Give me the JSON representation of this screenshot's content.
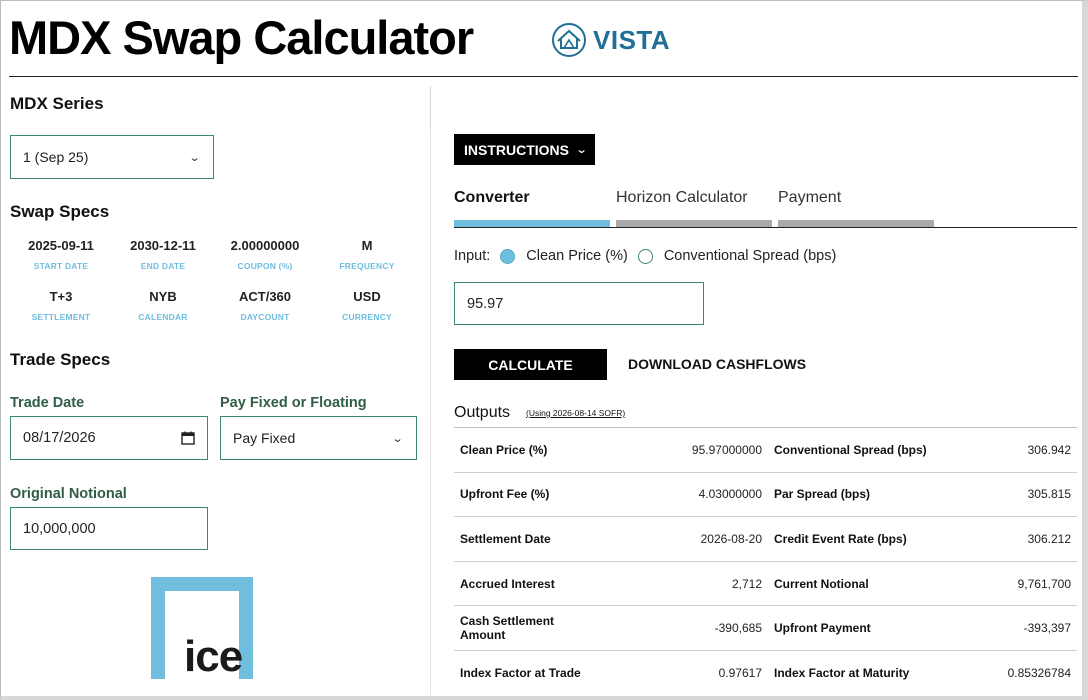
{
  "header": {
    "title": "MDX Swap Calculator",
    "brand": "VISTA"
  },
  "left": {
    "series_heading": "MDX Series",
    "series_select": "1 (Sep 25)",
    "swap_specs_heading": "Swap Specs",
    "swap_specs": [
      {
        "value": "2025-09-11",
        "label": "START DATE"
      },
      {
        "value": "2030-12-11",
        "label": "END DATE"
      },
      {
        "value": "2.00000000",
        "label": "COUPON (%)"
      },
      {
        "value": "M",
        "label": "FREQUENCY"
      },
      {
        "value": "T+3",
        "label": "SETTLEMENT"
      },
      {
        "value": "NYB",
        "label": "CALENDAR"
      },
      {
        "value": "ACT/360",
        "label": "DAYCOUNT"
      },
      {
        "value": "USD",
        "label": "CURRENCY"
      }
    ],
    "trade_specs_heading": "Trade Specs",
    "trade_date_label": "Trade Date",
    "trade_date_value": "08/17/2026",
    "pay_label": "Pay Fixed or Floating",
    "pay_value": "Pay Fixed",
    "notional_label": "Original Notional",
    "notional_value": "10,000,000",
    "footer_logo_text": "ICE"
  },
  "right": {
    "instructions_label": "INSTRUCTIONS",
    "tabs": [
      {
        "label": "Converter"
      },
      {
        "label": "Horizon Calculator"
      },
      {
        "label": "Payment"
      }
    ],
    "input_label": "Input:",
    "radio_clean": "Clean Price (%)",
    "radio_spread": "Conventional Spread (bps)",
    "input_value": "95.97",
    "calculate_label": "CALCULATE",
    "download_label": "DOWNLOAD CASHFLOWS",
    "outputs_heading": "Outputs",
    "outputs_note": "(Using 2026-08-14 SOFR)",
    "outputs": [
      [
        "Clean Price (%)",
        "95.97000000",
        "Conventional Spread (bps)",
        "306.942"
      ],
      [
        "Upfront Fee (%)",
        "4.03000000",
        "Par Spread (bps)",
        "305.815"
      ],
      [
        "Settlement Date",
        "2026-08-20",
        "Credit Event Rate (bps)",
        "306.212"
      ],
      [
        "Accrued Interest",
        "2,712",
        "Current Notional",
        "9,761,700"
      ],
      [
        "Cash Settlement Amount",
        "-390,685",
        "Upfront Payment",
        "-393,397"
      ],
      [
        "Index Factor at Trade",
        "0.97617",
        "Index Factor at Maturity",
        "0.85326784"
      ]
    ]
  },
  "colors": {
    "accent_blue": "#6fbede",
    "field_border": "#3c8a6b",
    "label_green": "#2f5d45",
    "brand_blue": "#1f6f96",
    "inactive_tab": "#a9a9a9"
  },
  "icons": {
    "brand_logo": "vista-house-icon",
    "dropdown": "chevron-down-icon",
    "calendar": "calendar-icon",
    "ice_logo": "ice-logo-icon"
  }
}
